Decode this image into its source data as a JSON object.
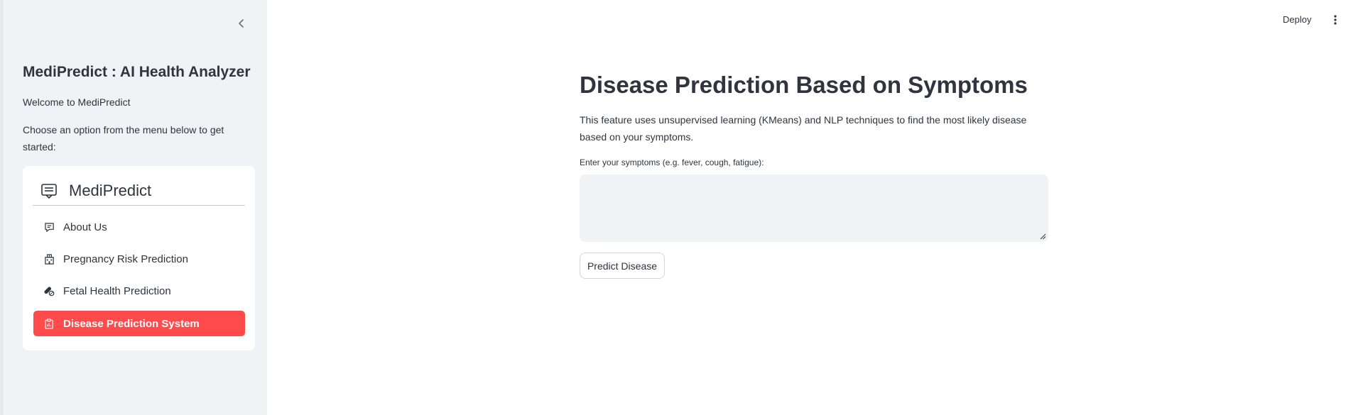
{
  "sidebar": {
    "title": "MediPredict : AI Health Analyzer",
    "welcome": "Welcome to MediPredict",
    "choose": "Choose an option from the menu below to get started:",
    "menu": {
      "title": "MediPredict",
      "items": [
        {
          "label": "About Us",
          "icon": "chat-icon"
        },
        {
          "label": "Pregnancy Risk Prediction",
          "icon": "hospital-icon"
        },
        {
          "label": "Fetal Health Prediction",
          "icon": "capsule-icon"
        },
        {
          "label": "Disease Prediction System",
          "icon": "clipboard-icon"
        }
      ],
      "active_index": 3
    }
  },
  "topbar": {
    "deploy_label": "Deploy"
  },
  "main": {
    "title": "Disease Prediction Based on Symptoms",
    "description": "This feature uses unsupervised learning (KMeans) and NLP techniques to find the most likely disease based on your symptoms.",
    "input_label": "Enter your symptoms (e.g. fever, cough, fatigue):",
    "input_value": "",
    "button_label": "Predict Disease"
  },
  "colors": {
    "accent": "#ff4b4b",
    "sidebar_bg": "#f0f2f6",
    "text": "#31333f"
  }
}
